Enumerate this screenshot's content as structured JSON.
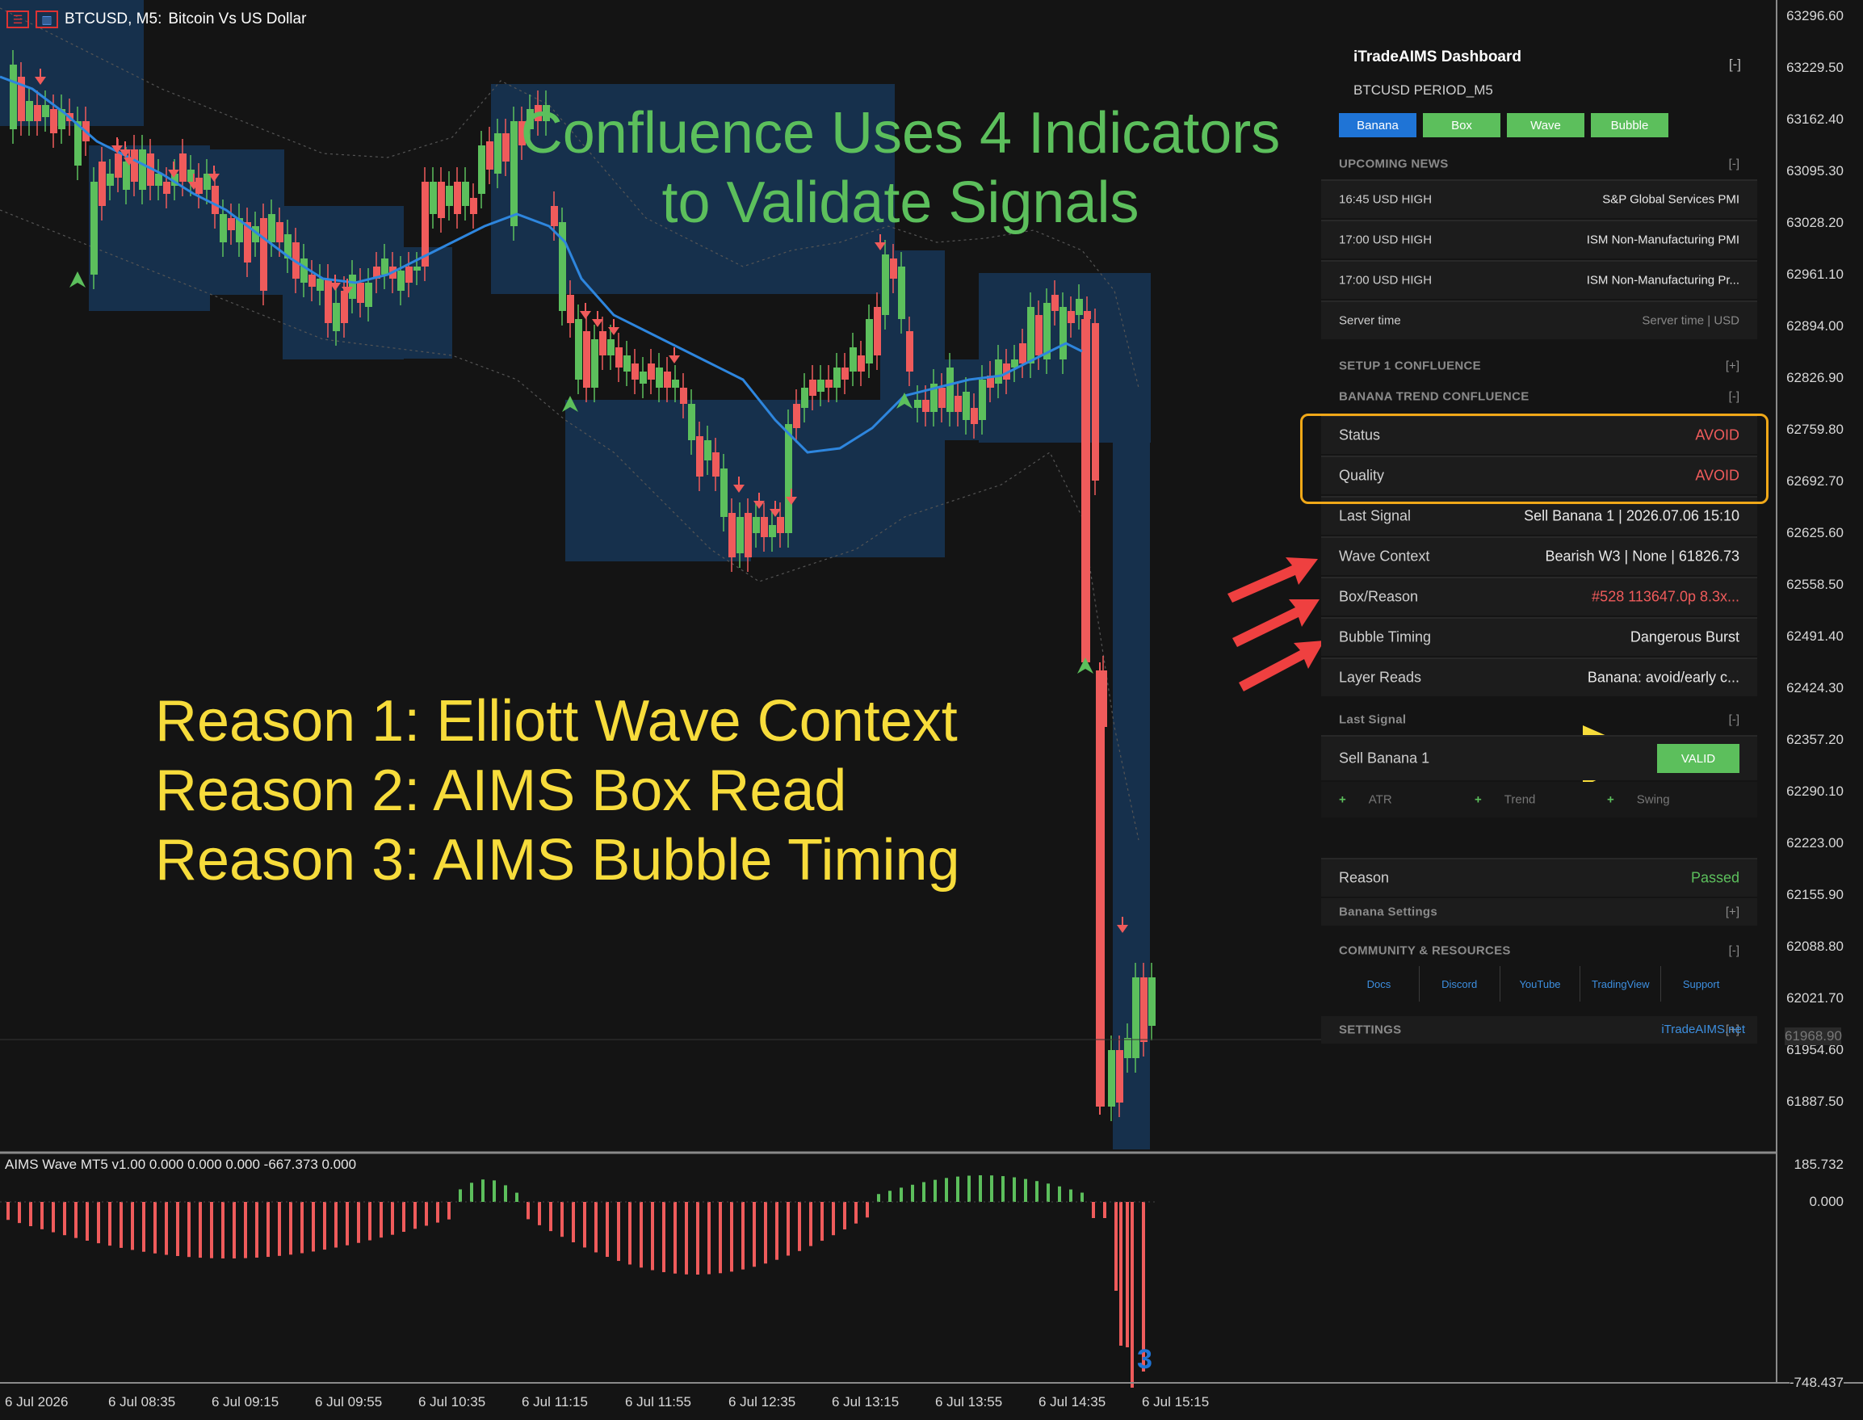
{
  "window": {
    "symbol_title": "BTCUSD, M5:",
    "symbol_desc": "Bitcoin Vs US Dollar"
  },
  "headline": {
    "line1": "Confluence Uses 4 Indicators",
    "line2": "to Validate Signals"
  },
  "reasons": [
    "Reason 1: Elliott Wave Context",
    "Reason 2: AIMS Box Read",
    "Reason 3: AIMS Bubble Timing"
  ],
  "price_axis": [
    "63296.60",
    "63229.50",
    "63162.40",
    "63095.30",
    "63028.20",
    "62961.10",
    "62894.00",
    "62826.90",
    "62759.80",
    "62692.70",
    "62625.60",
    "62558.50",
    "62491.40",
    "62424.30",
    "62357.20",
    "62290.10",
    "62223.00",
    "62155.90",
    "62088.80",
    "62021.70",
    "61954.60",
    "61887.50"
  ],
  "current_price": "61968.90",
  "time_axis": [
    "6 Jul 2026",
    "6 Jul 08:35",
    "6 Jul 09:15",
    "6 Jul 09:55",
    "6 Jul 10:35",
    "6 Jul 11:15",
    "6 Jul 11:55",
    "6 Jul 12:35",
    "6 Jul 13:15",
    "6 Jul 13:55",
    "6 Jul 14:35",
    "6 Jul 15:15"
  ],
  "indicator": {
    "title": "AIMS Wave MT5 v1.00 0.000 0.000 0.000 -667.373 0.000",
    "scale_top": "185.732",
    "scale_zero": "0.000",
    "scale_bottom": "-748.437",
    "wave_label": "3"
  },
  "dashboard": {
    "title": "iTradeAIMS Dashboard",
    "minimize": "[-]",
    "subtitle": "BTCUSD PERIOD_M5",
    "tabs": [
      "Banana",
      "Box",
      "Wave",
      "Bubble"
    ],
    "upcoming_news": {
      "header": "UPCOMING NEWS",
      "toggle": "[-]",
      "items": [
        {
          "time": "16:45 USD HIGH",
          "event": "S&P Global Services PMI"
        },
        {
          "time": "17:00 USD HIGH",
          "event": "ISM Non-Manufacturing PMI"
        },
        {
          "time": "17:00 USD HIGH",
          "event": "ISM Non-Manufacturing Pr..."
        }
      ],
      "server_time_label": "Server time",
      "server_time_value": "Server time | USD"
    },
    "setup_header": "SETUP 1 CONFLUENCE",
    "setup_toggle": "[+]",
    "banana_trend_header": "BANANA TREND CONFLUENCE",
    "banana_trend_toggle": "[-]",
    "rows": {
      "status": {
        "label": "Status",
        "value": "AVOID"
      },
      "quality": {
        "label": "Quality",
        "value": "AVOID"
      },
      "last_signal": {
        "label": "Last Signal",
        "value": "Sell Banana 1 | 2026.07.06 15:10"
      },
      "wave_context": {
        "label": "Wave Context",
        "value": "Bearish W3 | None | 61826.73"
      },
      "box_reason": {
        "label": "Box/Reason",
        "value": "#528 113647.0p  8.3x..."
      },
      "bubble_timing": {
        "label": "Bubble Timing",
        "value": "Dangerous Burst"
      },
      "layer_reads": {
        "label": "Layer Reads",
        "value": "Banana: avoid/early c..."
      }
    },
    "last_signal_section": {
      "header": "Last Signal",
      "toggle": "[-]",
      "signal": "Sell Banana 1",
      "button": "VALID",
      "filters": [
        {
          "mark": "+",
          "label": "ATR"
        },
        {
          "mark": "+",
          "label": "Trend"
        },
        {
          "mark": "+",
          "label": "Swing"
        }
      ],
      "reason_label": "Reason",
      "reason_value": "Passed"
    },
    "banana_settings": {
      "label": "Banana Settings",
      "toggle": "[+]"
    },
    "community": {
      "header": "COMMUNITY & RESOURCES",
      "toggle": "[-]",
      "links": [
        "Docs",
        "Discord",
        "YouTube",
        "TradingView",
        "Support"
      ]
    },
    "settings": {
      "label": "SETTINGS",
      "toggle": "[+]"
    },
    "site": "iTradeAIMS.net"
  },
  "colors": {
    "bull": "#5cbf5c",
    "bear": "#ef5b5b",
    "box": "#16304c",
    "ema": "#2e86de",
    "accent_blue": "#1f74d6",
    "highlight": "#f0a818",
    "headline_green": "#5cbf5c",
    "reason_yellow": "#f7dc3b"
  },
  "icons": [
    "menu-icon",
    "chart-type-icon",
    "arrow-down-icon",
    "arrow-up-icon",
    "pointer-arrow-icon"
  ]
}
